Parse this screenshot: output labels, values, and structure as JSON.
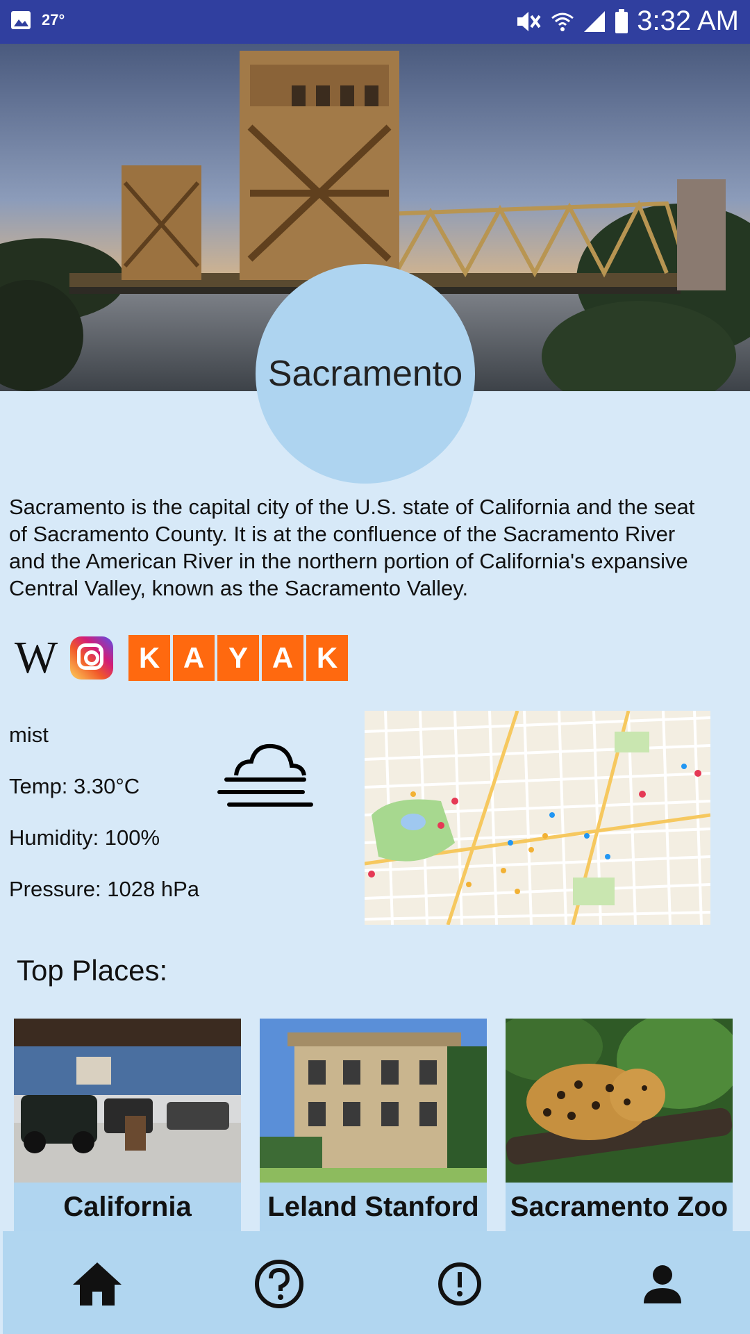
{
  "status_bar": {
    "temperature": "27°",
    "time": "3:32 AM",
    "icons": [
      "image-icon",
      "mute-icon",
      "wifi-icon",
      "signal-icon",
      "battery-icon"
    ]
  },
  "header": {
    "city_name": "Sacramento"
  },
  "description": "Sacramento is the capital city of the U.S. state of California and the seat of Sacramento County. It is at the confluence of the Sacramento River and the American River in the northern portion of California's expansive Central Valley, known as the Sacramento Valley.",
  "links": {
    "wikipedia_letter": "W",
    "kayak_letters": [
      "K",
      "A",
      "Y",
      "A",
      "K"
    ],
    "icons": [
      "wikipedia-icon",
      "instagram-icon",
      "kayak-logo"
    ]
  },
  "weather": {
    "condition": "mist",
    "temp": "Temp: 3.30°C",
    "humidity": "Humidity: 100%",
    "pressure": "Pressure: 1028 hPa",
    "icon": "mist-icon"
  },
  "top_places": {
    "title": "Top Places:",
    "places": [
      {
        "name": "California"
      },
      {
        "name": "Leland Stanford"
      },
      {
        "name": "Sacramento Zoo"
      }
    ]
  },
  "bottom_nav": {
    "items": [
      "home-icon",
      "help-icon",
      "alert-icon",
      "person-icon"
    ]
  },
  "colors": {
    "status_bar": "#303f9f",
    "background": "#d7e9f8",
    "accent": "#aed4f0",
    "kayak": "#ff690f"
  }
}
